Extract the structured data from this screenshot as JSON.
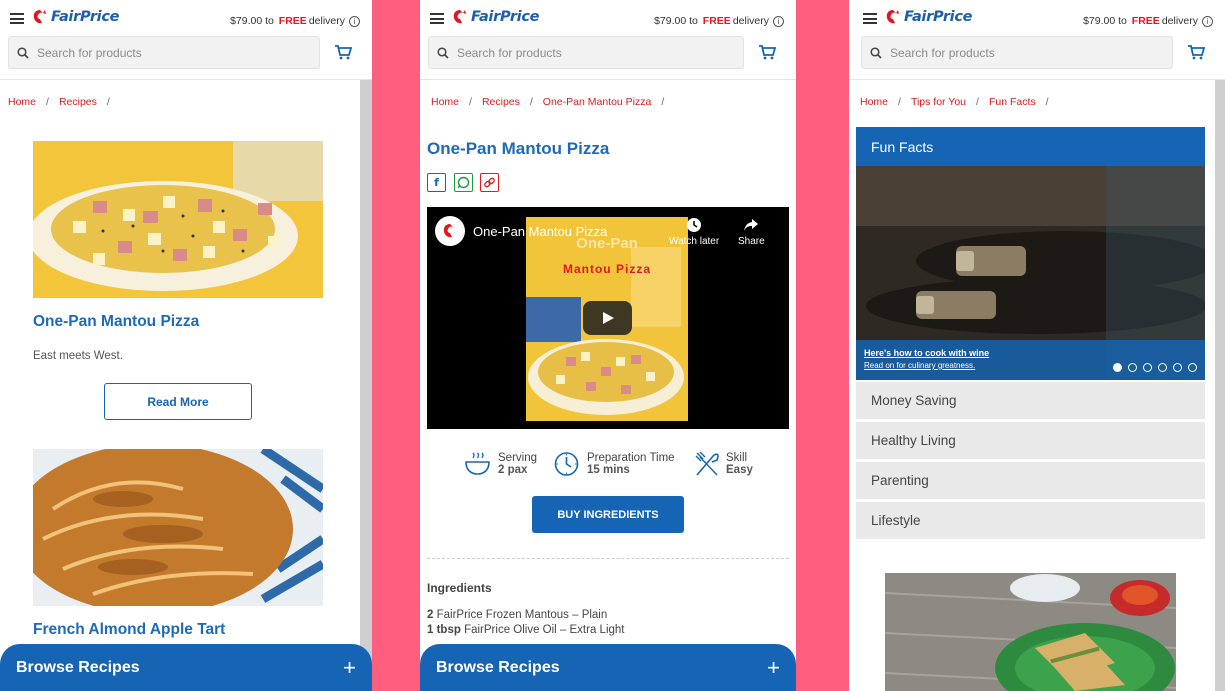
{
  "common": {
    "delivery_amount": "$79.00",
    "delivery_to": "to",
    "delivery_free": "FREE",
    "delivery_word": "delivery",
    "logo_text": "FairPrice",
    "search_placeholder": "Search for products",
    "browse_recipes": "Browse Recipes",
    "plus": "+"
  },
  "panel1": {
    "breadcrumb": [
      "Home",
      "Recipes"
    ],
    "recipe1_title": "One-Pan Mantou Pizza",
    "recipe1_desc": "East meets West.",
    "read_more": "Read More",
    "recipe2_title": "French Almond Apple Tart"
  },
  "panel2": {
    "breadcrumb": [
      "Home",
      "Recipes",
      "One-Pan Mantou Pizza"
    ],
    "title": "One-Pan Mantou Pizza",
    "video_title": "One-Pan Mantou Pizza",
    "video_overlay_line1": "One-Pan",
    "video_overlay_line2": "Mantou Pizza",
    "watch_later": "Watch later",
    "share": "Share",
    "serving_label": "Serving",
    "serving_value": "2 pax",
    "prep_label": "Preparation Time",
    "prep_value": "15 mins",
    "skill_label": "Skill",
    "skill_value": "Easy",
    "buy_ingredients": "BUY INGREDIENTS",
    "ingredients_heading": "Ingredients",
    "ingredients": [
      {
        "qty": "2",
        "item": "FairPrice Frozen Mantous – Plain"
      },
      {
        "qty": "1 tbsp",
        "item": "FairPrice Olive Oil – Extra Light"
      }
    ]
  },
  "panel3": {
    "breadcrumb": [
      "Home",
      "Tips for You",
      "Fun Facts"
    ],
    "section_title": "Fun Facts",
    "carousel_link": "Here's how to cook with wine",
    "carousel_sub": "Read on for culinary greatness.",
    "carousel_active_index": 0,
    "carousel_count": 6,
    "menu": [
      "Money Saving",
      "Healthy Living",
      "Parenting",
      "Lifestyle"
    ]
  },
  "colors": {
    "brand_blue": "#1565b4",
    "link_red": "#e1191f",
    "background_pink": "#ff5f7e"
  }
}
